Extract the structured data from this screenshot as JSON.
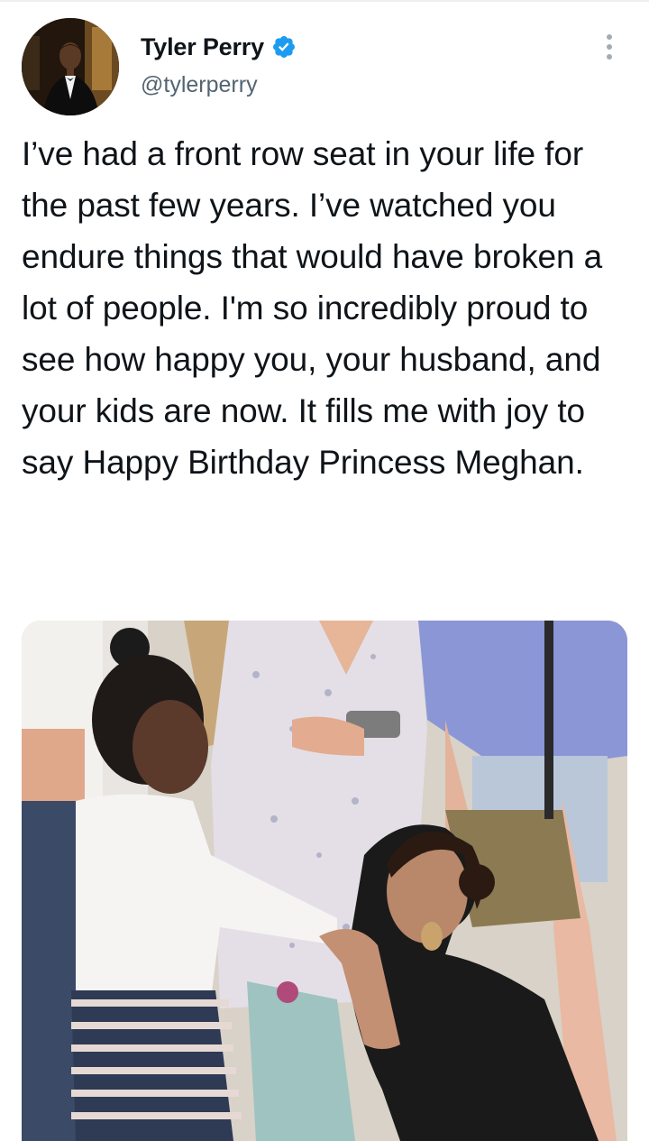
{
  "tweet": {
    "author": {
      "name": "Tyler Perry",
      "handle": "@tylerperry",
      "verified": true,
      "avatar_icon": "profile-photo-man-in-tuxedo"
    },
    "text": "I’ve had a front row seat in your life for the past few years. I’ve watched you endure things that would have broken a lot of people. I'm so incredibly proud to see how happy you, your husband, and your kids are now. It fills me with joy to say Happy Birthday Princess Meghan.",
    "media": {
      "type": "photo",
      "icon": "photo-woman-kissing-girls-hand"
    },
    "menu_icon": "more-vertical-icon"
  },
  "colors": {
    "text": "#0f1419",
    "secondary": "#536471",
    "verified": "#1d9bf0",
    "menu_dots": "#a3acb3"
  }
}
